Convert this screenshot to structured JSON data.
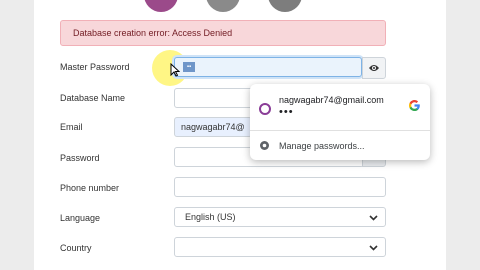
{
  "alert": {
    "message": "Database creation error: Access Denied"
  },
  "form": {
    "master_password": {
      "label": "Master Password",
      "value": ""
    },
    "database_name": {
      "label": "Database Name",
      "value": ""
    },
    "email": {
      "label": "Email",
      "value": "nagwagabr74@"
    },
    "password": {
      "label": "Password",
      "value": ""
    },
    "phone": {
      "label": "Phone number",
      "value": ""
    },
    "language": {
      "label": "Language",
      "value": "English (US)"
    },
    "country": {
      "label": "Country",
      "value": ""
    }
  },
  "autofill": {
    "account_email": "nagwagabr74@gmail.com",
    "account_password_mask": "•••",
    "manage_label": "Manage passwords..."
  },
  "colors": {
    "alert_bg": "#f8d7da",
    "alert_text": "#721c24",
    "focus_bg": "#eaf3fc",
    "avatar_ring": "#8a3d97",
    "top_circle_1": "#9b4a8a",
    "top_circle_2": "#8a8a8a",
    "top_circle_3": "#7d7d7d"
  },
  "icons": {
    "eye": "eye-icon",
    "google": "google-logo-icon",
    "key": "key-icon",
    "chevron": "chevron-down-icon",
    "cursor": "mouse-pointer-icon"
  }
}
